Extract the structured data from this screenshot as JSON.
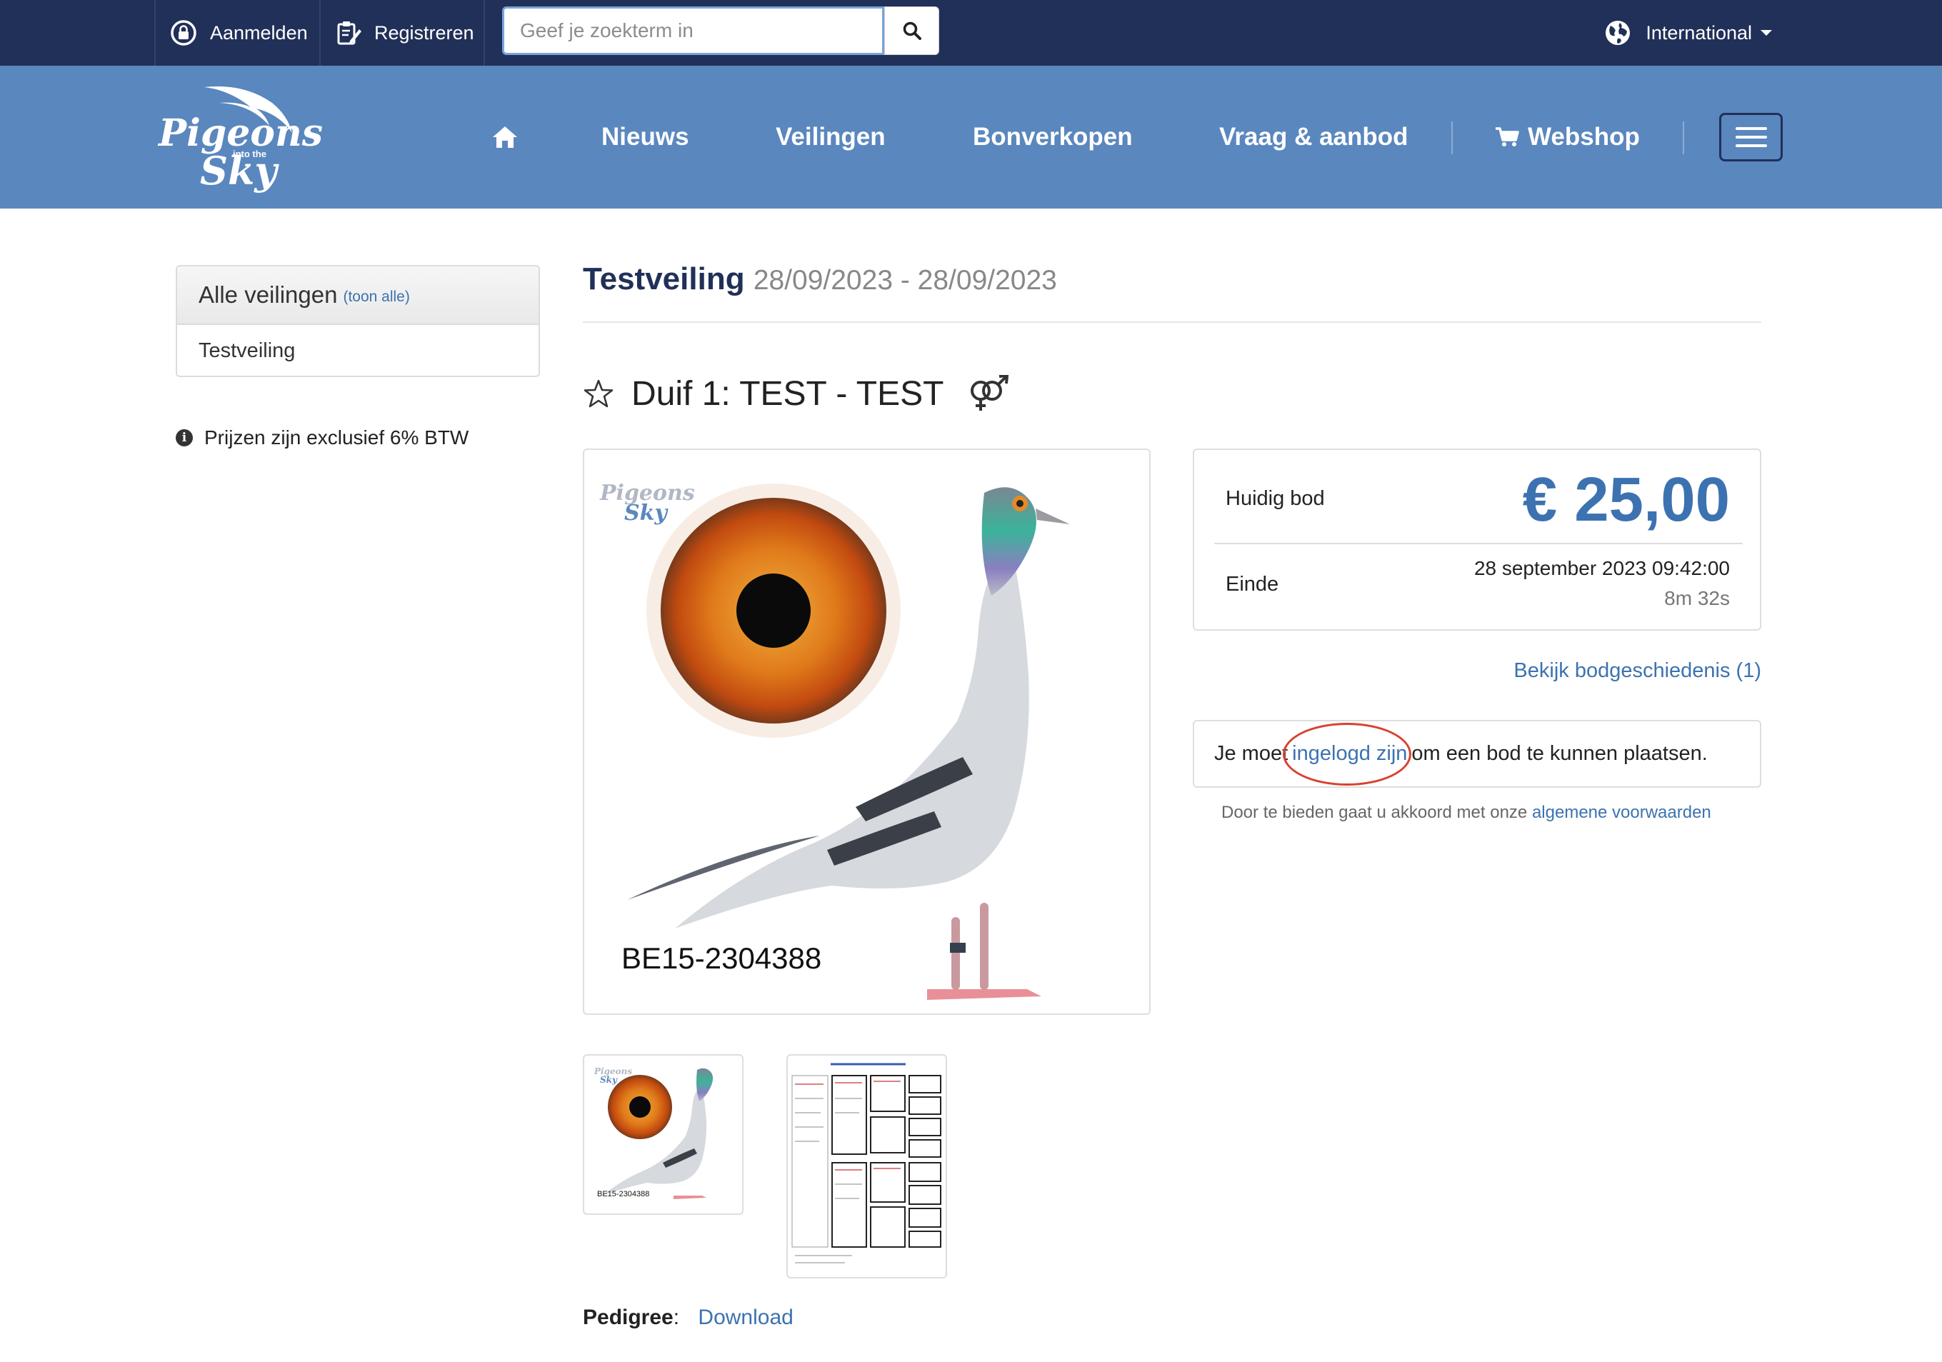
{
  "topbar": {
    "login_label": "Aanmelden",
    "register_label": "Registreren",
    "search_placeholder": "Geef je zoekterm in",
    "region_label": "International"
  },
  "nav": {
    "logo_text": "Pigeons into the Sky",
    "items": [
      "Nieuws",
      "Veilingen",
      "Bonverkopen",
      "Vraag & aanbod"
    ],
    "webshop_label": "Webshop"
  },
  "sidebar": {
    "heading": "Alle veilingen",
    "show_all": "(toon alle)",
    "items": [
      "Testveiling"
    ],
    "vat_note": "Prijzen zijn exclusief 6% BTW"
  },
  "auction": {
    "title": "Testveiling",
    "dates": "28/09/2023 - 28/09/2023"
  },
  "pigeon": {
    "heading": "Duif 1: TEST - TEST",
    "ring_number": "BE15-2304388",
    "pedigree_label": "Pedigree",
    "pedigree_sep": ":",
    "download_label": "Download"
  },
  "bid": {
    "current_label": "Huidig bod",
    "amount": "€ 25,00",
    "end_label": "Einde",
    "end_date": "28 september 2023 09:42:00",
    "remaining": "8m 32s",
    "history_link": "Bekijk bodgeschiedenis (1)",
    "login_prefix": "Je moet",
    "login_link": "ingelogd zijn",
    "login_suffix": "om een bod te kunnen plaatsen.",
    "terms_text": "Door te bieden gaat u akkoord met onze",
    "terms_link": "algemene voorwaarden"
  },
  "colors": {
    "topbar": "#213058",
    "navbar": "#5a87be",
    "accent": "#3c72b0",
    "highlight_circle": "#d8412f"
  }
}
